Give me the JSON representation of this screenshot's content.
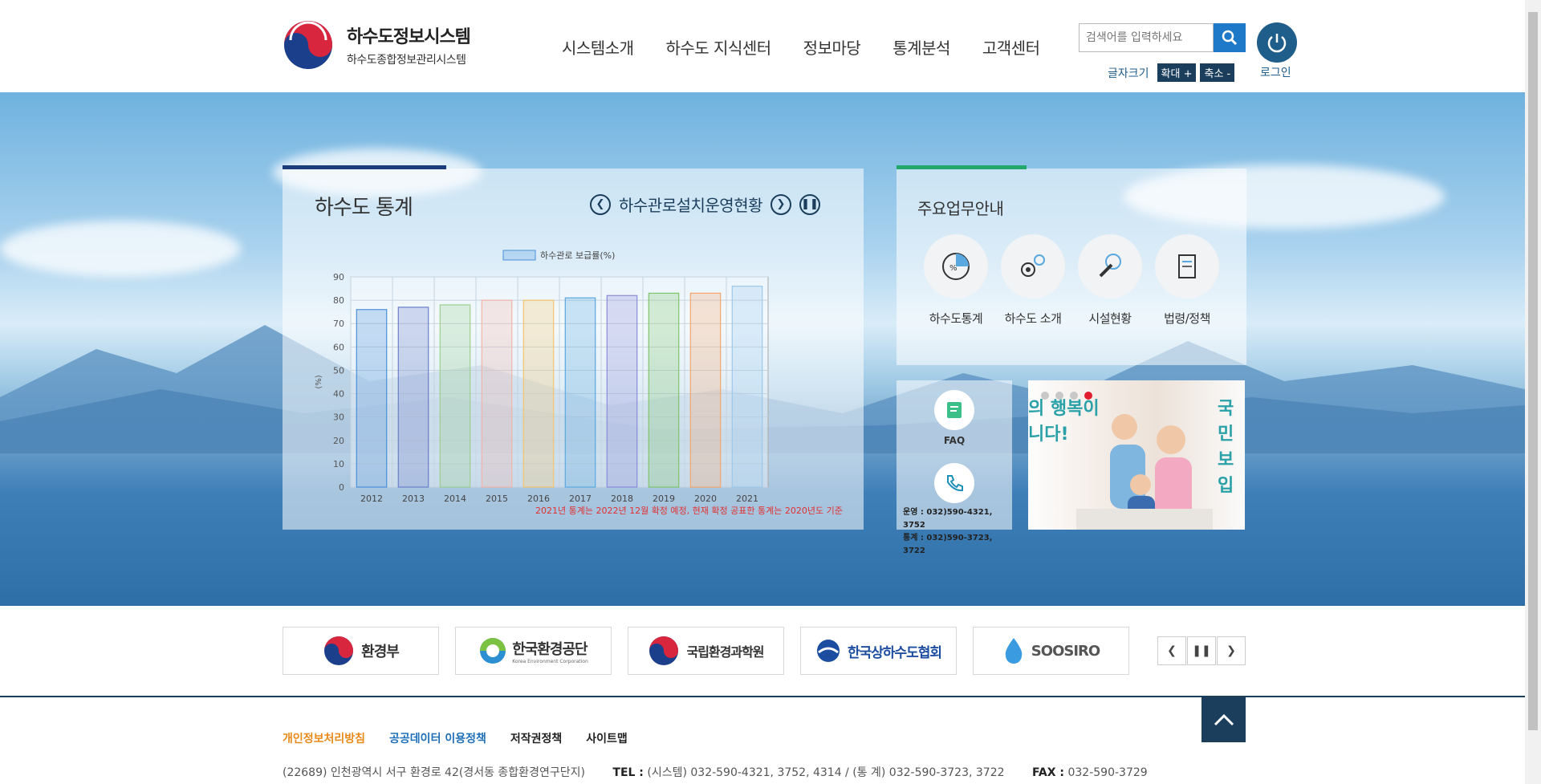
{
  "header": {
    "logo_title": "하수도정보시스템",
    "logo_sub": "하수도종합정보관리시스템",
    "nav": [
      "시스템소개",
      "하수도 지식센터",
      "정보마당",
      "통계분석",
      "고객센터"
    ],
    "search_placeholder": "검색어를 입력하세요",
    "font_size_label": "글자크기",
    "font_increase": "확대 +",
    "font_decrease": "축소 -",
    "login_label": "로그인"
  },
  "stats": {
    "title": "하수도 통계",
    "subtitle": "하수관로설치운영현황",
    "note": "2021년 통계는 2022년 12월 확정 예정, 현재 확정 공표한 통계는 2020년도 기준"
  },
  "chart_data": {
    "type": "bar",
    "legend": "하수관로 보급률(%)",
    "ylabel": "(%)",
    "ylim": [
      0,
      90
    ],
    "yticks": [
      0,
      10,
      20,
      30,
      40,
      50,
      60,
      70,
      80,
      90
    ],
    "categories": [
      "2012",
      "2013",
      "2014",
      "2015",
      "2016",
      "2017",
      "2018",
      "2019",
      "2020",
      "2021"
    ],
    "values": [
      76,
      77,
      78,
      80,
      80,
      81,
      82,
      83,
      83,
      86
    ],
    "colors": [
      "#4a90d9",
      "#6a7ec9",
      "#9ccf8f",
      "#f1b4a8",
      "#f5c46a",
      "#5aa8e0",
      "#8b8bd8",
      "#7dc46a",
      "#f5a56a",
      "#9cc8ec"
    ]
  },
  "biz": {
    "title": "주요업무안내",
    "items": [
      "하수도통계",
      "하수도 소개",
      "시설현황",
      "법령/정책"
    ]
  },
  "support": {
    "faq_label": "FAQ",
    "phone_op": "운영 : 032)590-4321, 3752",
    "phone_stat": "통계 : 032)590-3723, 3722"
  },
  "banner": {
    "text_left_1": "의 행복이",
    "text_left_2": "니다!",
    "text_right_1": "국민",
    "text_right_2": "보입"
  },
  "partners": [
    "환경부",
    "한국환경공단",
    "국립환경과학원",
    "한국상하수도협회",
    "SOOSIRO"
  ],
  "partners_sub": {
    "kec": "Korea Environment Corporation"
  },
  "footer": {
    "links": [
      "개인정보처리방침",
      "공공데이터 이용정책",
      "저작권정책",
      "사이트맵"
    ],
    "address": "(22689) 인천광역시 서구 환경로 42(경서동 종합환경연구단지)",
    "tel_label": "TEL :",
    "tel": "(시스템) 032-590-4321, 3752, 4314 / (통 계) 032-590-3723, 3722",
    "fax_label": "FAX :",
    "fax": "032-590-3729"
  },
  "colors": {
    "navy": "#1b3e5c",
    "accent_blue": "#1e7ac8",
    "accent_green": "#22a86b",
    "note_red": "#e03030"
  }
}
